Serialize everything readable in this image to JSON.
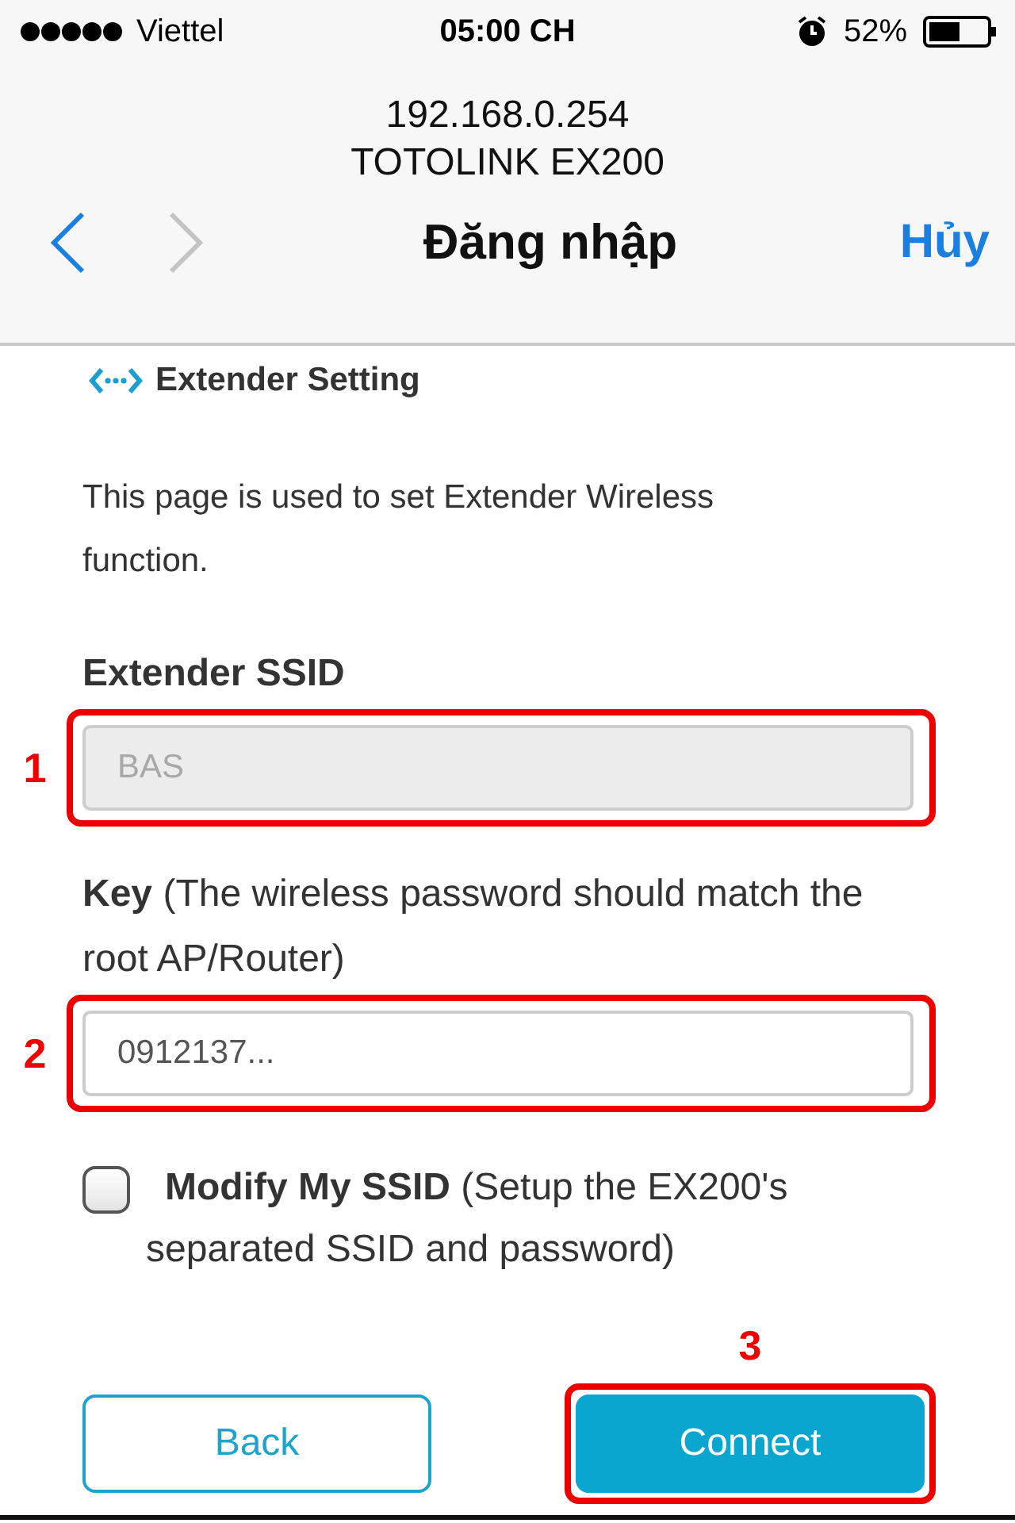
{
  "status_bar": {
    "carrier": "Viettel",
    "time": "05:00 CH",
    "battery": "52%"
  },
  "browser": {
    "address": "192.168.0.254",
    "page_title": "TOTOLINK EX200",
    "title": "Đăng nhập",
    "cancel": "Hủy",
    "nav_buttons": [
      {
        "kind": "back",
        "disabled": false
      },
      {
        "kind": "forward",
        "disabled": true
      }
    ]
  },
  "section": {
    "title": "Extender Setting",
    "description": "This page is used to set Extender Wireless function."
  },
  "fields": [
    {
      "label": "Extender SSID",
      "label_bold": true,
      "value": "BAS",
      "disabled": true,
      "annotation": "1"
    },
    {
      "label": "**Key** (The wireless password should match the root AP/Router)",
      "label_bold": false,
      "value": "0912137...",
      "disabled": false,
      "annotation": "2"
    }
  ],
  "checkbox": {
    "label": "**Modify My SSID** (Setup the EX200's separated SSID and password)",
    "checked": false
  },
  "buttons": [
    {
      "label": "Back",
      "kind": "outline"
    },
    {
      "label": "Connect",
      "kind": "primary",
      "annotation": "3"
    }
  ]
}
